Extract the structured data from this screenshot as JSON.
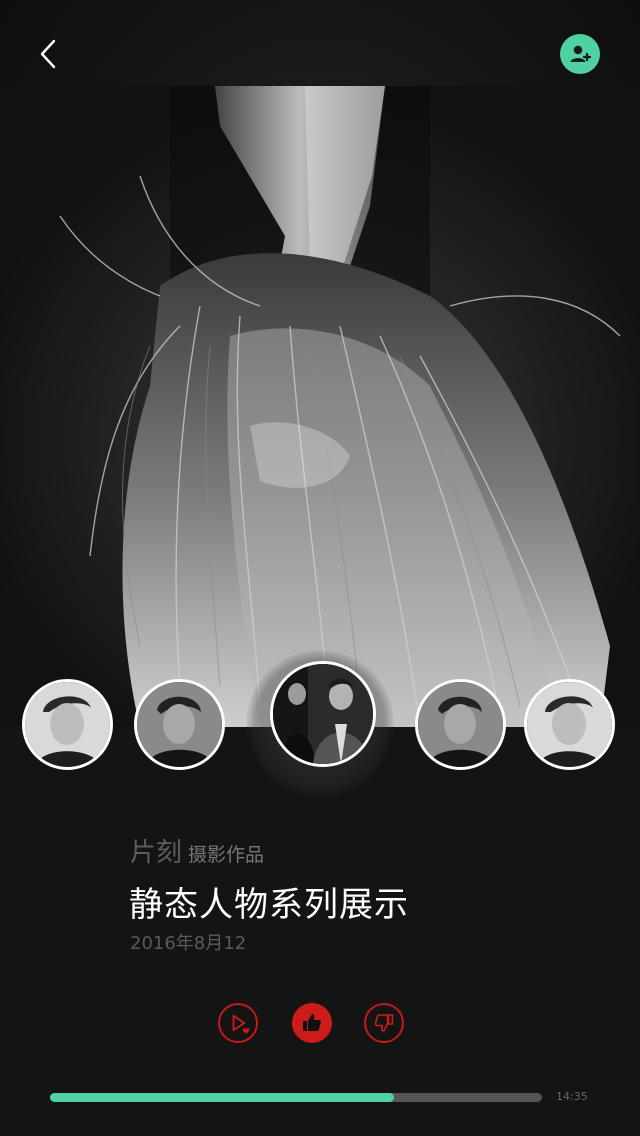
{
  "header": {
    "back_icon": "chevron-left-icon",
    "add_user_icon": "add-user-icon",
    "accent_color": "#4fd1a1"
  },
  "hero": {
    "image": "black-and-white portrait of hanging hair"
  },
  "avatars": [
    {
      "icon": "portrait-man",
      "selected": false
    },
    {
      "icon": "portrait-man",
      "selected": false
    },
    {
      "icon": "portrait-couple-suits",
      "selected": true
    },
    {
      "icon": "portrait-man",
      "selected": false
    },
    {
      "icon": "portrait-man",
      "selected": false
    }
  ],
  "work": {
    "brand": "片刻",
    "type": "摄影作品",
    "title": "静态人物系列展示",
    "date": "2016年8月12"
  },
  "actions": [
    {
      "icon": "play-heart-icon",
      "active": false,
      "color": "#cc1b1b"
    },
    {
      "icon": "thumbs-up-icon",
      "active": true,
      "color": "#cc1b1b"
    },
    {
      "icon": "thumbs-down-icon",
      "active": false,
      "color": "#cc1b1b"
    }
  ],
  "player": {
    "progress": 0.7,
    "time": "14:35",
    "progress_color": "#4fd1a1"
  }
}
